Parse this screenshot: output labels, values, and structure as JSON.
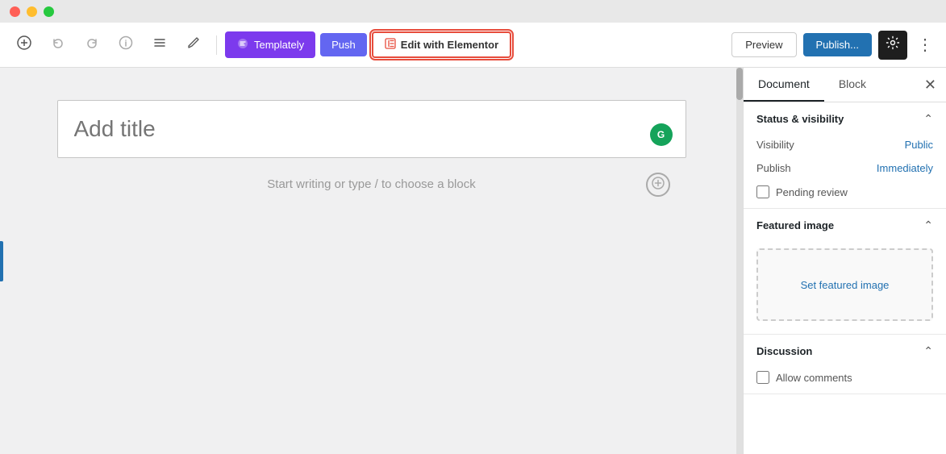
{
  "titleBar": {
    "trafficLights": [
      "red",
      "yellow",
      "green"
    ]
  },
  "toolbar": {
    "addLabel": "+",
    "undoLabel": "↩",
    "redoLabel": "↪",
    "infoLabel": "i",
    "listLabel": "≡",
    "penLabel": "✏",
    "templatelyLabel": "Templately",
    "pushLabel": "Push",
    "elementorLabel": "Edit with Elementor",
    "previewLabel": "Preview",
    "publishLabel": "Publish...",
    "settingsLabel": "⚙",
    "moreLabel": "⋮"
  },
  "editor": {
    "titlePlaceholder": "Add title",
    "writePlaceholder": "Start writing or type / to choose a block",
    "grammarlyInitial": "G"
  },
  "sidebar": {
    "tabs": [
      {
        "id": "document",
        "label": "Document",
        "active": true
      },
      {
        "id": "block",
        "label": "Block",
        "active": false
      }
    ],
    "sections": {
      "statusVisibility": {
        "title": "Status & visibility",
        "visibility": {
          "label": "Visibility",
          "value": "Public"
        },
        "publish": {
          "label": "Publish",
          "value": "Immediately"
        },
        "pendingReview": {
          "label": "Pending review",
          "checked": false
        }
      },
      "featuredImage": {
        "title": "Featured image",
        "setLabel": "Set featured image"
      },
      "discussion": {
        "title": "Discussion",
        "allowComments": {
          "label": "Allow comments",
          "checked": false
        }
      }
    }
  }
}
